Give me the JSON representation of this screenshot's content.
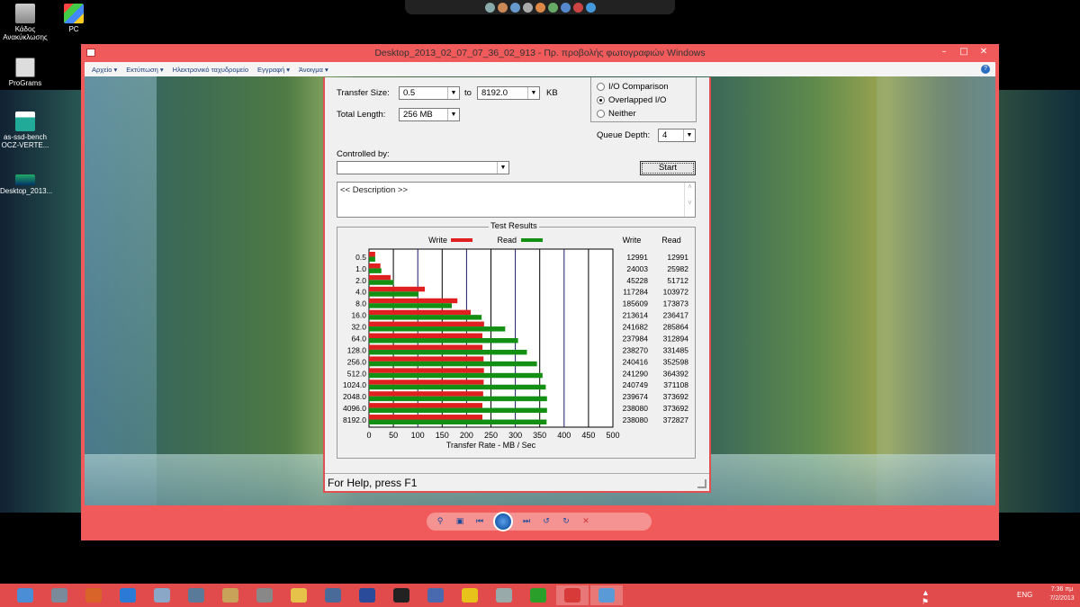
{
  "desktop": {
    "icons": [
      {
        "label": "Κάδος Ανακύκλωσης",
        "icon": "recycle-bin-icon"
      },
      {
        "label": "PC",
        "icon": "computer-icon"
      },
      {
        "label": "ProGrams",
        "icon": "folder-icon"
      },
      {
        "label": "as-ssd-bench OCZ-VERTE...",
        "icon": "image-file-icon"
      },
      {
        "label": "Desktop_2013...",
        "icon": "image-file-icon"
      }
    ]
  },
  "viewer": {
    "title": "Desktop_2013_02_07_07_36_02_913 - Πρ. προβολής φωτογραφιών Windows",
    "menu": [
      "Αρχείο",
      "Εκτύπωση",
      "Ηλεκτρονικό ταχυδρομείο",
      "Εγγραφή",
      "Άνοιγμα"
    ],
    "accent": "#f05a5a"
  },
  "app": {
    "transfer_size_label": "Transfer Size:",
    "transfer_from": "0.5",
    "to_label": "to",
    "transfer_to": "8192.0",
    "kb_label": "KB",
    "total_length_label": "Total Length:",
    "total_length": "256 MB",
    "radio_io_comparison": "I/O Comparison",
    "radio_overlapped": "Overlapped I/O",
    "radio_neither": "Neither",
    "queue_depth_label": "Queue Depth:",
    "queue_depth": "4",
    "controlled_by_label": "Controlled by:",
    "controlled_by": "",
    "start_label": "Start",
    "description": "<< Description >>",
    "results_title": "Test Results",
    "status": "For Help, press F1"
  },
  "chart_data": {
    "type": "bar",
    "orientation": "horizontal",
    "title": "Test Results",
    "xlabel": "Transfer Rate - MB / Sec",
    "xlim": [
      0,
      500
    ],
    "xticks": [
      "0",
      "50",
      "100",
      "150",
      "200",
      "250",
      "300",
      "350",
      "400",
      "450",
      "500"
    ],
    "categories": [
      "0.5",
      "1.0",
      "2.0",
      "4.0",
      "8.0",
      "16.0",
      "32.0",
      "64.0",
      "128.0",
      "256.0",
      "512.0",
      "1024.0",
      "2048.0",
      "4096.0",
      "8192.0"
    ],
    "series": [
      {
        "name": "Write",
        "color": "#e02020",
        "values": [
          12.7,
          23.4,
          44.2,
          114.5,
          181.3,
          208.6,
          235.9,
          232.4,
          232.7,
          234.8,
          235.6,
          235.1,
          234.1,
          232.5,
          232.5
        ],
        "labels": [
          "12991",
          "24003",
          "45228",
          "117284",
          "185609",
          "213614",
          "241682",
          "237984",
          "238270",
          "240416",
          "241290",
          "240749",
          "239674",
          "238080",
          "238080"
        ]
      },
      {
        "name": "Read",
        "color": "#139013",
        "values": [
          12.7,
          25.4,
          50.5,
          101.5,
          169.8,
          230.9,
          279.2,
          305.6,
          323.7,
          344.3,
          355.8,
          362.4,
          364.9,
          364.9,
          364.1
        ],
        "labels": [
          "12991",
          "25982",
          "51712",
          "103972",
          "173873",
          "236417",
          "285864",
          "312894",
          "331485",
          "352598",
          "364392",
          "371108",
          "373692",
          "373692",
          "372827"
        ]
      }
    ],
    "legend": "top",
    "grid": true
  },
  "taskbar": {
    "apps": [
      "windows-explorer-icon",
      "control-panel-icon",
      "paint-icon",
      "internet-explorer-icon",
      "notepad-icon",
      "calculator-icon",
      "paint-palette-icon",
      "tools-icon",
      "folder-icon",
      "network-icon",
      "powershell-icon",
      "cmd-icon",
      "remote-desktop-icon",
      "x-app-icon",
      "printer-icon",
      "utorrent-icon",
      "atto-icon",
      "photo-viewer-icon"
    ],
    "lang": "ENG",
    "time": "7:36 πμ",
    "date": "7/2/2013"
  }
}
